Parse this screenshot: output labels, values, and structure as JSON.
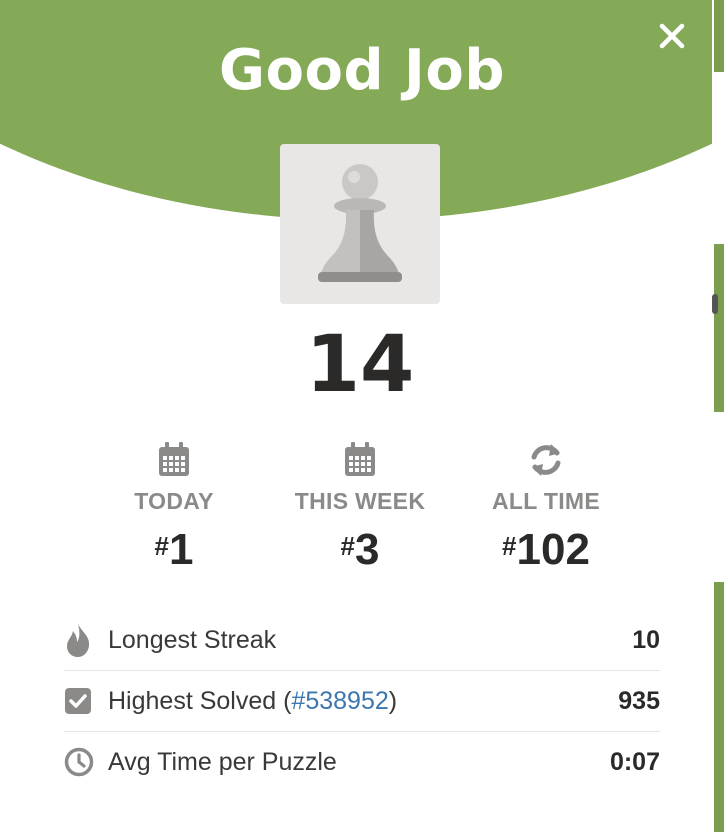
{
  "header": {
    "title": "Good Job",
    "close_icon": "close-icon"
  },
  "score": "14",
  "rankings": [
    {
      "icon": "calendar-icon",
      "label": "TODAY",
      "hash": "#",
      "value": "1"
    },
    {
      "icon": "calendar-icon",
      "label": "THIS WEEK",
      "hash": "#",
      "value": "3"
    },
    {
      "icon": "refresh-icon",
      "label": "ALL TIME",
      "hash": "#",
      "value": "102"
    }
  ],
  "stats": [
    {
      "icon": "flame-icon",
      "label": "Longest Streak",
      "value": "10"
    },
    {
      "icon": "checkbox-icon",
      "label_prefix": "Highest Solved (",
      "link": "#538952",
      "label_suffix": ")",
      "value": "935"
    },
    {
      "icon": "clock-icon",
      "label": "Avg Time per Puzzle",
      "value": "0:07"
    }
  ],
  "colors": {
    "header_green": "#84aa58",
    "link_blue": "#3d77b0"
  }
}
